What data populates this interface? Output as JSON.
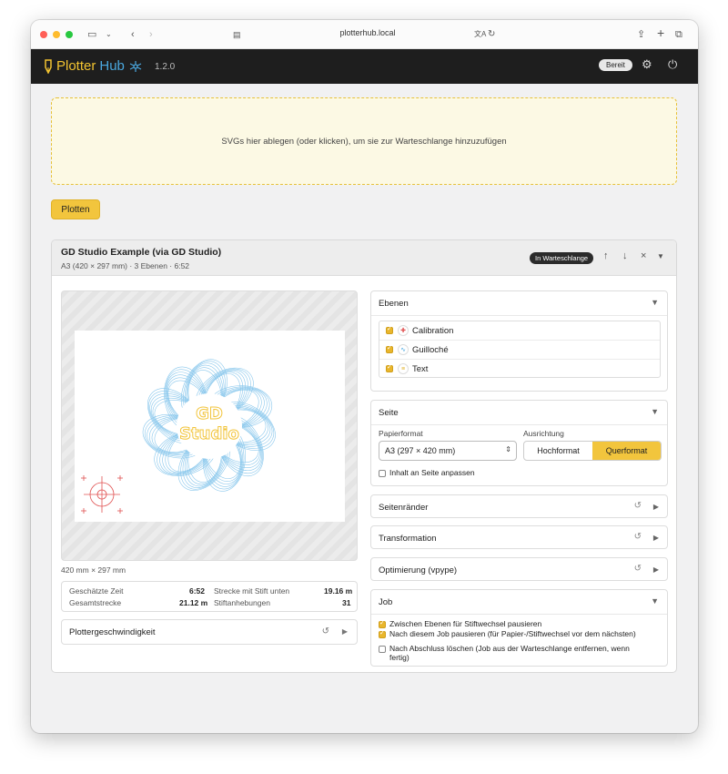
{
  "browser": {
    "url": "plotterhub.local"
  },
  "app": {
    "brand_plotter": "Plotter",
    "brand_hub": "Hub",
    "version": "1.2.0",
    "status": "Bereit"
  },
  "dropzone": {
    "text": "SVGs hier ablegen (oder klicken), um sie zur Warteschlange hinzuzufügen"
  },
  "actions": {
    "plot_label": "Plotten"
  },
  "job": {
    "title": "GD Studio Example (via GD Studio)",
    "subtitle": "A3 (420 × 297 mm) · 3 Ebenen · 6:52",
    "badge": "In Warteschlange",
    "preview_text_line1": "GD",
    "preview_text_line2": "Studio",
    "dimensions": "420 mm × 297 mm",
    "stats": {
      "est_time_label": "Geschätzte Zeit",
      "est_time_value": "6:52",
      "total_label": "Gesamtstrecke",
      "total_value": "21.12 m",
      "pen_down_label": "Strecke mit Stift unten",
      "pen_down_value": "19.16 m",
      "lifts_label": "Stiftanhebungen",
      "lifts_value": "31"
    },
    "speed_label": "Plottergeschwindigkeit"
  },
  "layers": {
    "heading": "Ebenen",
    "items": [
      {
        "name": "Calibration",
        "color": "#e05050"
      },
      {
        "name": "Guilloché",
        "color": "#4aa8e0"
      },
      {
        "name": "Text",
        "color": "#f2c53d"
      }
    ]
  },
  "page": {
    "heading": "Seite",
    "paper_label": "Papierformat",
    "paper_value": "A3 (297 × 420 mm)",
    "orientation_label": "Ausrichtung",
    "portrait": "Hochformat",
    "landscape": "Querformat",
    "fit_label": "Inhalt an Seite anpassen"
  },
  "sections": {
    "margins": "Seitenränder",
    "transform": "Transformation",
    "optimize": "Optimierung (vpype)"
  },
  "job_options": {
    "heading": "Job",
    "opt1": "Zwischen Ebenen für Stiftwechsel pausieren",
    "opt2": "Nach diesem Job pausieren (für Papier-/Stiftwechsel vor dem nächsten)",
    "opt3_line1": "Nach Abschluss löschen (Job aus der Warteschlange entfernen, wenn",
    "opt3_line2": "fertig)"
  },
  "colors": {
    "accent": "#f2c53d",
    "header_bg": "#1e1e1e",
    "guilloche": "#4aa8e0",
    "calibration": "#e05050"
  }
}
